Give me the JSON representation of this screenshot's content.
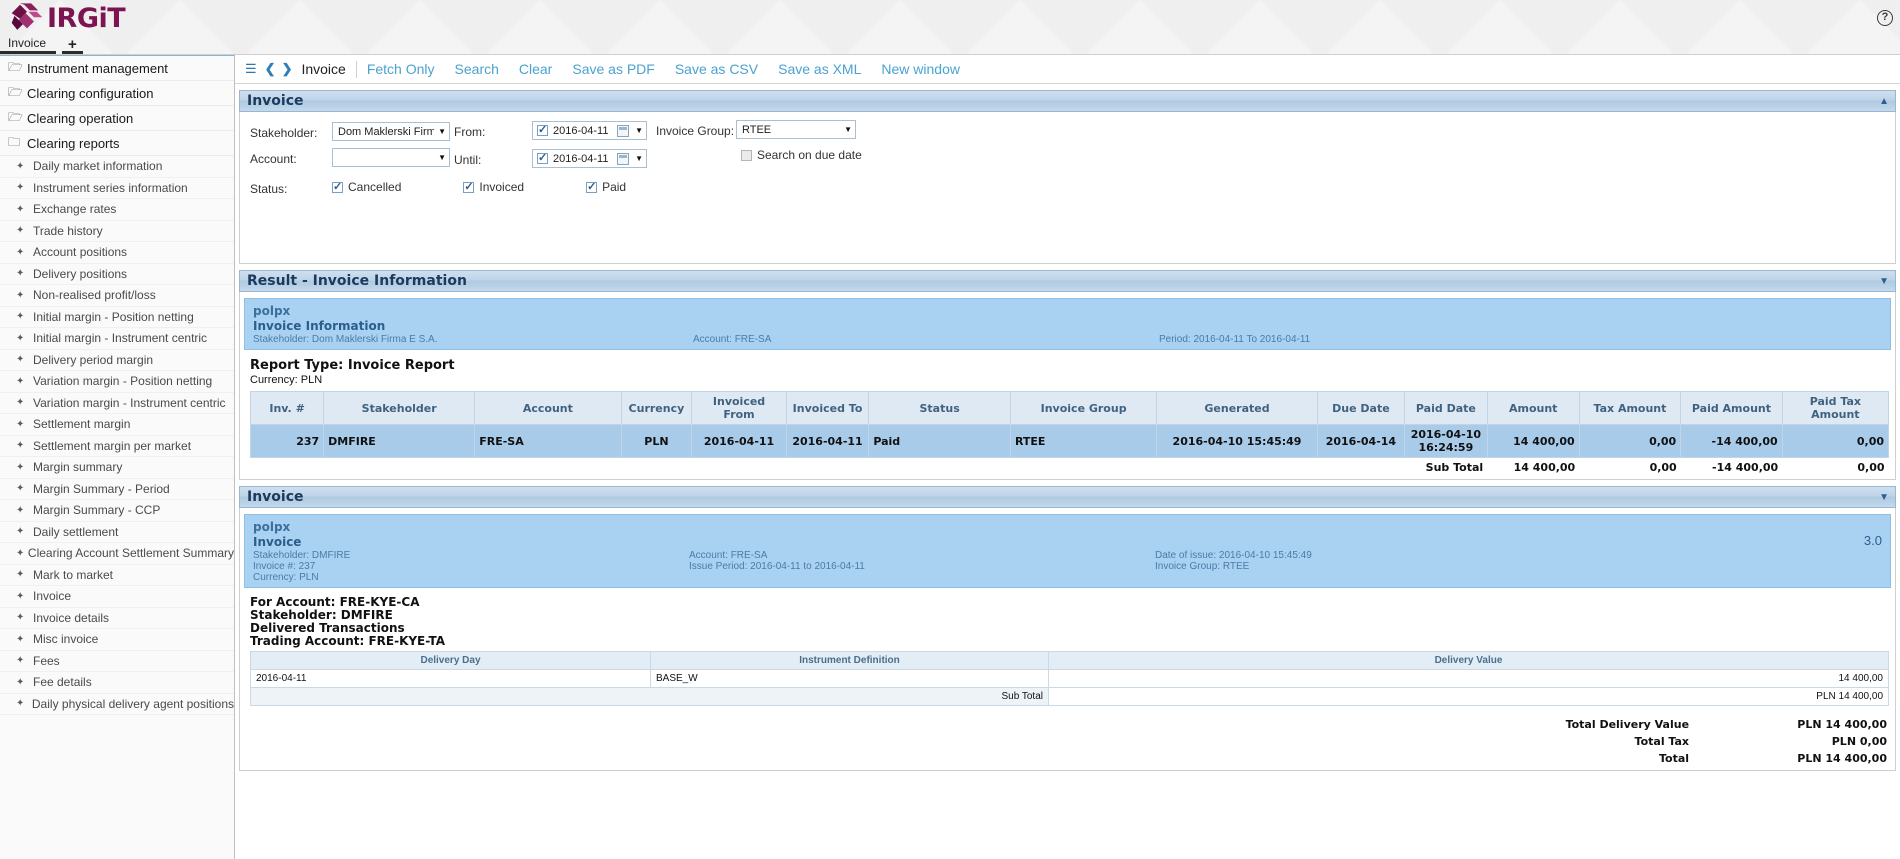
{
  "app": {
    "brand": "IRGiT",
    "tab_label": "Invoice",
    "add_tab_label": "+",
    "help_label": "?"
  },
  "sidebar": {
    "groups": [
      {
        "label": "Instrument management",
        "icon": "folder-closed-icon"
      },
      {
        "label": "Clearing configuration",
        "icon": "folder-closed-icon"
      },
      {
        "label": "Clearing operation",
        "icon": "folder-closed-icon"
      },
      {
        "label": "Clearing reports",
        "icon": "folder-open-icon"
      }
    ],
    "items": [
      "Daily market information",
      "Instrument series information",
      "Exchange rates",
      "Trade history",
      "Account positions",
      "Delivery positions",
      "Non-realised profit/loss",
      "Initial margin - Position netting",
      "Initial margin - Instrument centric",
      "Delivery period margin",
      "Variation margin - Position netting",
      "Variation margin - Instrument centric",
      "Settlement margin",
      "Settlement margin per market",
      "Margin summary",
      "Margin Summary - Period",
      "Margin Summary - CCP",
      "Daily settlement",
      "Clearing Account Settlement Summary",
      "Mark to market",
      "Invoice",
      "Invoice details",
      "Misc invoice",
      "Fees",
      "Fee details",
      "Daily physical delivery agent positions"
    ]
  },
  "toolbar": {
    "title": "Invoice",
    "links": [
      "Fetch Only",
      "Search",
      "Clear",
      "Save as PDF",
      "Save as CSV",
      "Save as XML",
      "New window"
    ]
  },
  "search_panel": {
    "title": "Invoice",
    "stakeholder_label": "Stakeholder:",
    "stakeholder_value": "Dom Maklerski Firma E",
    "account_label": "Account:",
    "account_value": "",
    "status_label": "Status:",
    "from_label": "From:",
    "from_value": "2016-04-11",
    "until_label": "Until:",
    "until_value": "2016-04-11",
    "invoice_group_label": "Invoice Group:",
    "invoice_group_value": "RTEE",
    "search_due_date_label": "Search on due date",
    "status_options": [
      {
        "label": "Cancelled",
        "checked": true
      },
      {
        "label": "Invoiced",
        "checked": true
      },
      {
        "label": "Paid",
        "checked": true
      }
    ]
  },
  "result_panel": {
    "title": "Result - Invoice Information",
    "band": {
      "brand": "polpx",
      "title": "Invoice Information",
      "stakeholder": "Stakeholder: Dom Maklerski Firma E S.A.",
      "account": "Account: FRE-SA",
      "period": "Period: 2016-04-11 To 2016-04-11"
    },
    "report_type": "Report Type: Invoice Report",
    "currency_line": "Currency: PLN",
    "columns": [
      "Inv. #",
      "Stakeholder",
      "Account",
      "Currency",
      "Invoiced From",
      "Invoiced To",
      "Status",
      "Invoice Group",
      "Generated",
      "Due Date",
      "Paid Date",
      "Amount",
      "Tax Amount",
      "Paid Amount",
      "Paid Tax Amount"
    ],
    "rows": [
      {
        "inv_no": "237",
        "stakeholder": "DMFIRE",
        "account": "FRE-SA",
        "currency": "PLN",
        "invoiced_from": "2016-04-11",
        "invoiced_to": "2016-04-11",
        "status": "Paid",
        "invoice_group": "RTEE",
        "generated": "2016-04-10 15:45:49",
        "due_date": "2016-04-14",
        "paid_date": "2016-04-10 16:24:59",
        "amount": "14 400,00",
        "tax_amount": "0,00",
        "paid_amount": "-14 400,00",
        "paid_tax_amount": "0,00"
      }
    ],
    "subtotal": {
      "label": "Sub Total",
      "amount": "14 400,00",
      "tax_amount": "0,00",
      "paid_amount": "-14 400,00",
      "paid_tax_amount": "0,00"
    }
  },
  "invoice_panel": {
    "title": "Invoice",
    "band": {
      "brand": "polpx",
      "title": "Invoice",
      "stakeholder": "Stakeholder: DMFIRE",
      "invoice_no": "Invoice #: 237",
      "currency": "Currency: PLN",
      "account": "Account: FRE-SA",
      "issue_period": "Issue Period: 2016-04-11 to 2016-04-11",
      "date_of_issue": "Date of issue: 2016-04-10 15:45:49",
      "invoice_group": "Invoice Group: RTEE",
      "version": "3.0"
    },
    "for_account": "For Account: FRE-KYE-CA",
    "stakeholder": "Stakeholder: DMFIRE",
    "delivered_transactions": "Delivered Transactions",
    "trading_account": "Trading Account: FRE-KYE-TA",
    "columns": [
      "Delivery Day",
      "Instrument Definition",
      "Delivery Value"
    ],
    "rows": [
      {
        "delivery_day": "2016-04-11",
        "instrument": "BASE_W",
        "delivery_value": "14 400,00"
      }
    ],
    "subtotal_label": "Sub Total",
    "subtotal_value": "PLN 14 400,00",
    "totals": [
      {
        "label": "Total Delivery Value",
        "value": "PLN 14 400,00"
      },
      {
        "label": "Total Tax",
        "value": "PLN 0,00"
      },
      {
        "label": "Total",
        "value": "PLN 14 400,00"
      }
    ]
  },
  "colors": {
    "brand": "#7b1450",
    "link": "#4aa3cf",
    "band": "#a9d2f2",
    "row": "#a9cbea"
  }
}
